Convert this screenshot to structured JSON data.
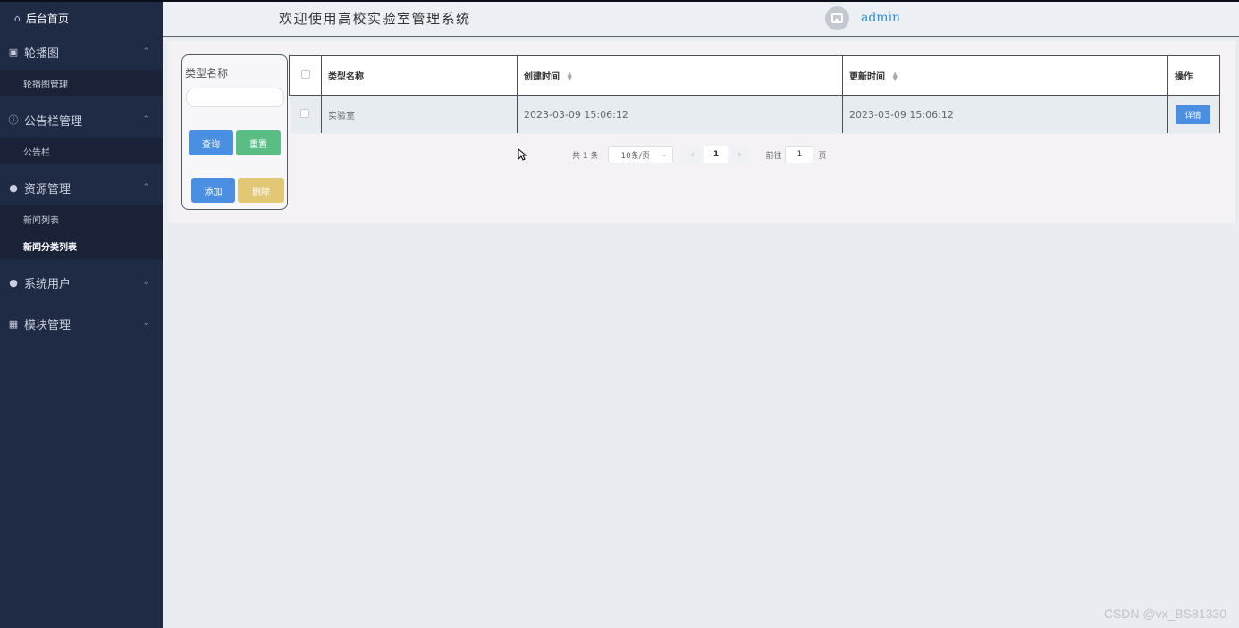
{
  "sidebar": {
    "home_label": "后台首页",
    "groups": [
      {
        "label": "轮播图",
        "items": [
          "轮播图管理"
        ]
      },
      {
        "label": "公告栏管理",
        "items": [
          "公告栏"
        ]
      },
      {
        "label": "资源管理",
        "items": [
          "新闻列表",
          "新闻分类列表"
        ]
      },
      {
        "label": "系统用户"
      },
      {
        "label": "模块管理"
      }
    ]
  },
  "header": {
    "title": "欢迎使用高校实验室管理系统",
    "username": "admin"
  },
  "search": {
    "label": "类型名称",
    "value": "",
    "query_label": "查询",
    "reset_label": "重置",
    "add_label": "添加",
    "delete_label": "删除"
  },
  "table": {
    "columns": [
      "类型名称",
      "创建时间",
      "更新时间",
      "操作"
    ],
    "rows": [
      {
        "name": "实验室",
        "created": "2023-03-09 15:06:12",
        "updated": "2023-03-09 15:06:12",
        "action_label": "详情"
      }
    ]
  },
  "pagination": {
    "total": "共 1 条",
    "page_size": "10条/页",
    "current_page": "1",
    "goto_label": "前往",
    "goto_value": "1",
    "page_unit": "页"
  },
  "watermark": "CSDN @vx_BS81330"
}
